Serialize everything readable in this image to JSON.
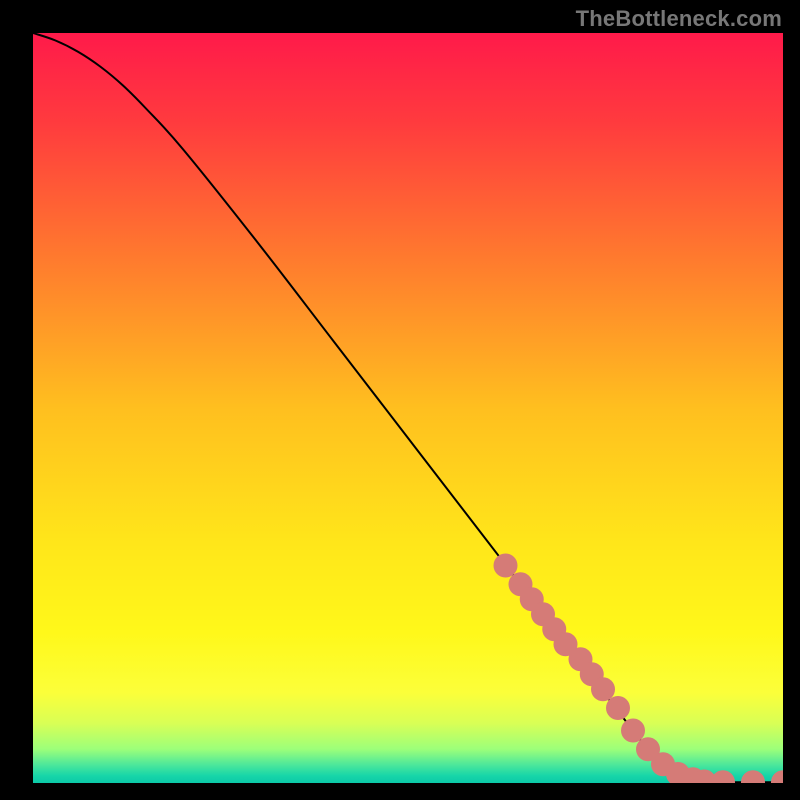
{
  "attribution": "TheBottleneck.com",
  "colors": {
    "background": "#000000",
    "line": "#000000",
    "marker": "#d57b77",
    "gradient_stops": [
      {
        "offset": 0.0,
        "color": "#ff1a4a"
      },
      {
        "offset": 0.12,
        "color": "#ff3b3e"
      },
      {
        "offset": 0.3,
        "color": "#ff7a2e"
      },
      {
        "offset": 0.5,
        "color": "#ffbf1f"
      },
      {
        "offset": 0.68,
        "color": "#ffe61a"
      },
      {
        "offset": 0.8,
        "color": "#fff81a"
      },
      {
        "offset": 0.88,
        "color": "#fbff3a"
      },
      {
        "offset": 0.92,
        "color": "#d9ff55"
      },
      {
        "offset": 0.955,
        "color": "#9cff7a"
      },
      {
        "offset": 0.975,
        "color": "#4fe89a"
      },
      {
        "offset": 0.99,
        "color": "#18d6a8"
      },
      {
        "offset": 1.0,
        "color": "#0bc9a8"
      }
    ]
  },
  "chart_data": {
    "type": "line",
    "xlim": [
      0,
      100
    ],
    "ylim": [
      0,
      100
    ],
    "xlabel": "",
    "ylabel": "",
    "title": "",
    "legend": [],
    "series": [
      {
        "name": "curve",
        "x": [
          0,
          3,
          6,
          9,
          12,
          15,
          20,
          30,
          40,
          50,
          60,
          65,
          70,
          75,
          80,
          82,
          84,
          86,
          88,
          89,
          90,
          92,
          95,
          100
        ],
        "y": [
          100,
          99,
          97.5,
          95.5,
          93,
          90,
          84.5,
          72,
          59,
          46,
          33,
          26.5,
          20,
          13.5,
          7,
          4.5,
          2.5,
          1.2,
          0.5,
          0.2,
          0.1,
          0.1,
          0.1,
          0.1
        ]
      }
    ],
    "markers": {
      "name": "highlight-points",
      "x": [
        63,
        65,
        66.5,
        68,
        69.5,
        71,
        73,
        74.5,
        76,
        78,
        80,
        82,
        84,
        86,
        88,
        89.5,
        92,
        96,
        100
      ],
      "y": [
        29,
        26.5,
        24.5,
        22.5,
        20.5,
        18.5,
        16.5,
        14.5,
        12.5,
        10,
        7,
        4.5,
        2.5,
        1.2,
        0.5,
        0.2,
        0.1,
        0.1,
        0.1
      ],
      "radius": 1.6
    }
  }
}
